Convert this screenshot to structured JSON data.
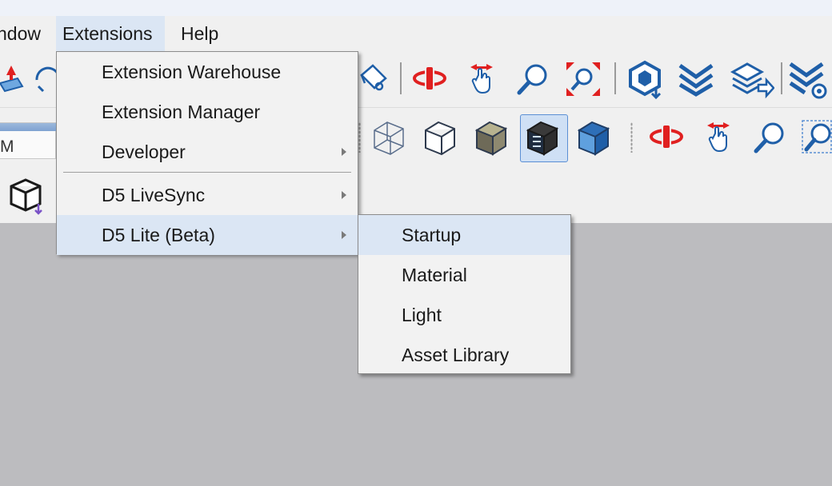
{
  "menubar": {
    "items": [
      {
        "label": "ndow"
      },
      {
        "label": "Extensions"
      },
      {
        "label": "Help"
      }
    ]
  },
  "scene_field": {
    "value": "M"
  },
  "extensions_menu": {
    "items": [
      {
        "label": "Extension Warehouse",
        "submenu": false
      },
      {
        "label": "Extension Manager",
        "submenu": false
      },
      {
        "label": "Developer",
        "submenu": true
      },
      {
        "label": "D5 LiveSync",
        "submenu": true
      },
      {
        "label": "D5 Lite (Beta)",
        "submenu": true,
        "highlighted": true
      }
    ]
  },
  "d5_lite_submenu": {
    "items": [
      {
        "label": "Startup",
        "highlighted": true
      },
      {
        "label": "Material"
      },
      {
        "label": "Light"
      },
      {
        "label": "Asset Library"
      }
    ]
  },
  "toolbar_icons": {
    "row1": [
      "push-pull-icon",
      "follow-me-icon",
      "paint-bucket-icon",
      "orbit-icon",
      "pan-icon",
      "zoom-icon",
      "zoom-extents-icon",
      "d5-render-icon",
      "d5-sync-icon",
      "d5-export-icon",
      "d5-settings-icon"
    ],
    "row2": [
      "xray-style-icon",
      "hidden-line-style-icon",
      "shaded-style-icon",
      "shaded-textures-style-icon",
      "monochrome-style-icon",
      "orbit-icon",
      "pan-icon",
      "zoom-icon",
      "zoom-window-icon"
    ],
    "row3": [
      "component-download-icon"
    ]
  },
  "colors": {
    "menu_highlight": "#dbe6f4",
    "toolbar_bg": "#f0f0f0",
    "canvas_bg": "#bcbcbf",
    "accent_blue": "#1f5fa8",
    "accent_red": "#e02020"
  }
}
